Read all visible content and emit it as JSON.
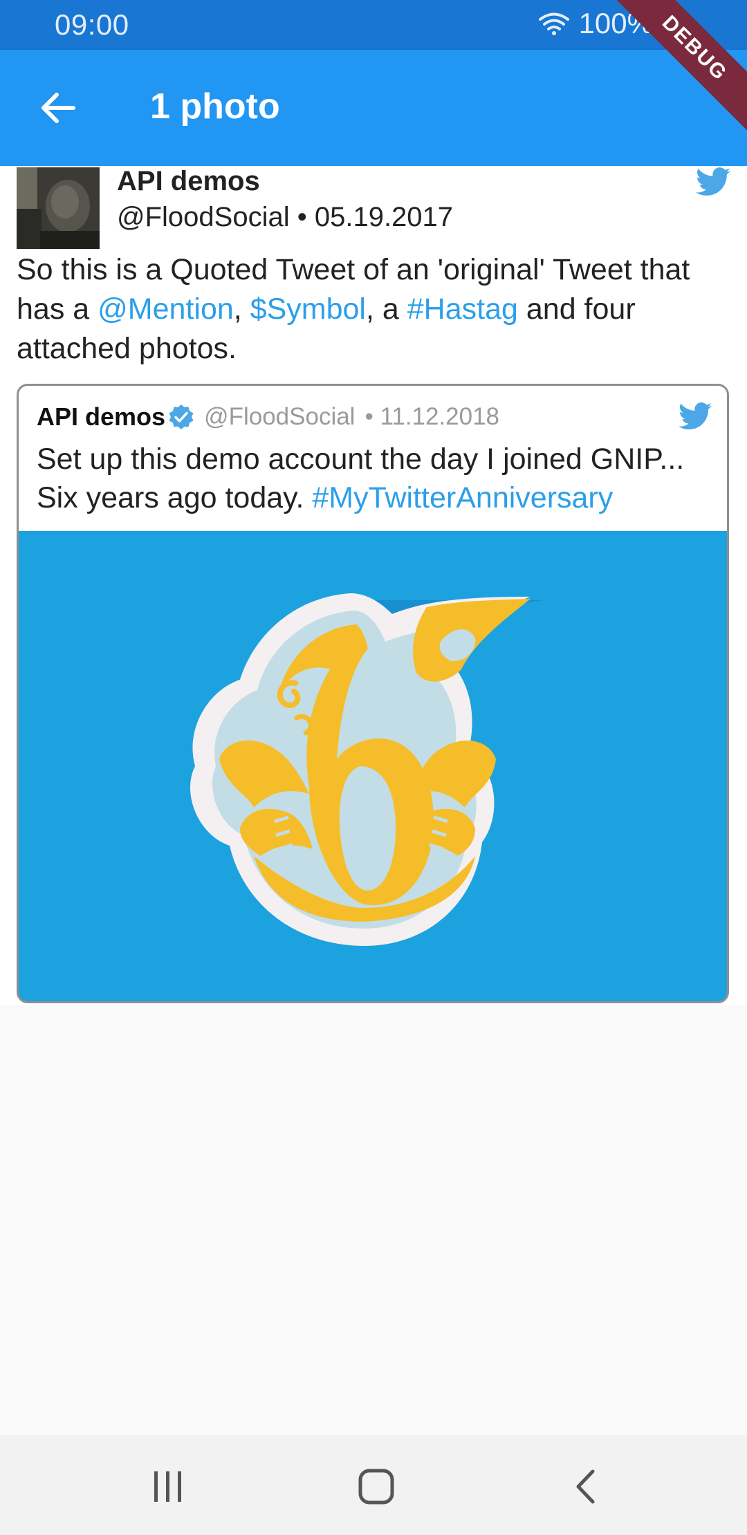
{
  "status_bar": {
    "time": "09:00",
    "battery": "100%",
    "icons": [
      "wifi-icon",
      "battery-icon"
    ]
  },
  "debug_banner": "DEBUG",
  "app_bar": {
    "title": "1 photo",
    "back_icon": "arrow-left-icon"
  },
  "tweet": {
    "author_name": "API demos",
    "handle_date": "@FloodSocial • 05.19.2017",
    "text_parts": {
      "p1": "So this is a Quoted Tweet of an 'original' Tweet that has a ",
      "mention": "@Mention",
      "p2": ",  ",
      "symbol": "$Symbol",
      "p3": ", a ",
      "hashtag": "#Hastag",
      "p4": " and four attached photos."
    },
    "quoted": {
      "author_name": "API demos",
      "handle": "@FloodSocial",
      "date": "• 11.12.2018",
      "text": "Set up this demo account the day I joined GNIP... Six years ago today. ",
      "hashtag": "#MyTwitterAnniversary"
    }
  },
  "colors": {
    "status_bar": "#1976d2",
    "app_bar": "#2196f3",
    "link": "#2b9fe9",
    "twitter_blue": "#4ba7e6",
    "image_bg": "#1ca2de",
    "debug": "#7b2a3d"
  },
  "nav_bar": {
    "icons": [
      "recents-icon",
      "home-icon",
      "back-icon"
    ]
  }
}
